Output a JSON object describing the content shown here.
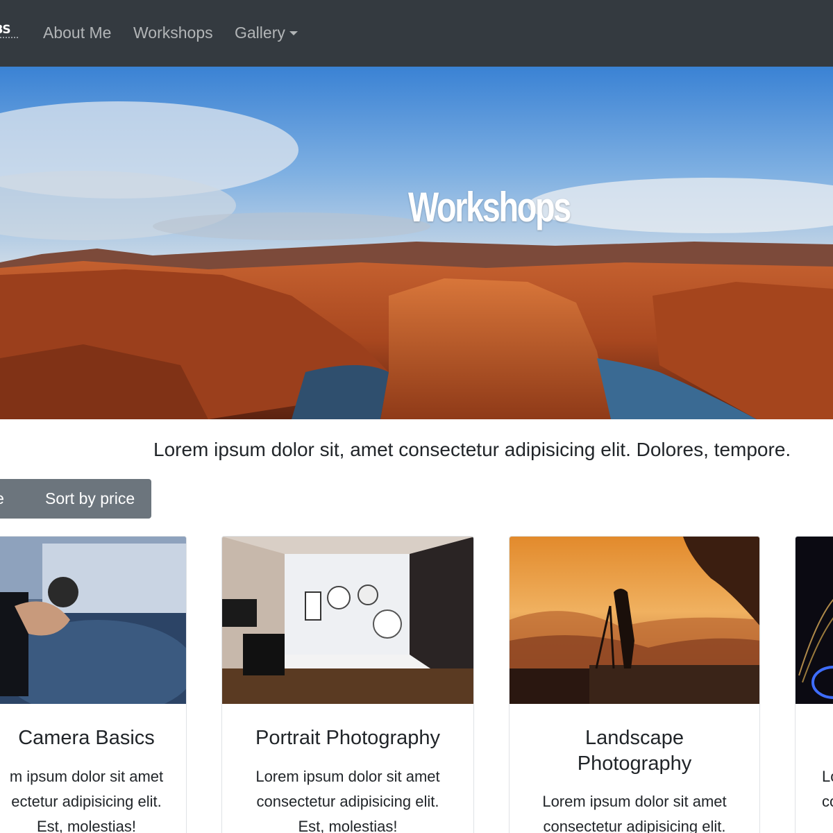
{
  "navbar": {
    "brand": "OBS",
    "links": [
      {
        "label": "About Me"
      },
      {
        "label": "Workshops"
      },
      {
        "label": "Gallery"
      }
    ]
  },
  "hero": {
    "title": "Workshops"
  },
  "intro": {
    "text": "Lorem ipsum dolor sit, amet consectetur adipisicing elit. Dolores, tempore."
  },
  "sort": {
    "by_date": "ate",
    "by_price": "Sort by price"
  },
  "cards": [
    {
      "title": "Camera Basics",
      "text_lines": [
        "m ipsum dolor sit amet",
        "ectetur adipisicing elit.",
        "Est, molestias!"
      ]
    },
    {
      "title": "Portrait Photography",
      "text_lines": [
        "Lorem ipsum dolor sit amet",
        "consectetur adipisicing elit.",
        "Est, molestias!"
      ]
    },
    {
      "title_lines": [
        "Landscape",
        "Photography"
      ],
      "text_lines": [
        "Lorem ipsum dolor sit amet",
        "consectetur adipisicing elit."
      ]
    },
    {
      "text_lines": [
        "Lo",
        "co"
      ]
    }
  ]
}
